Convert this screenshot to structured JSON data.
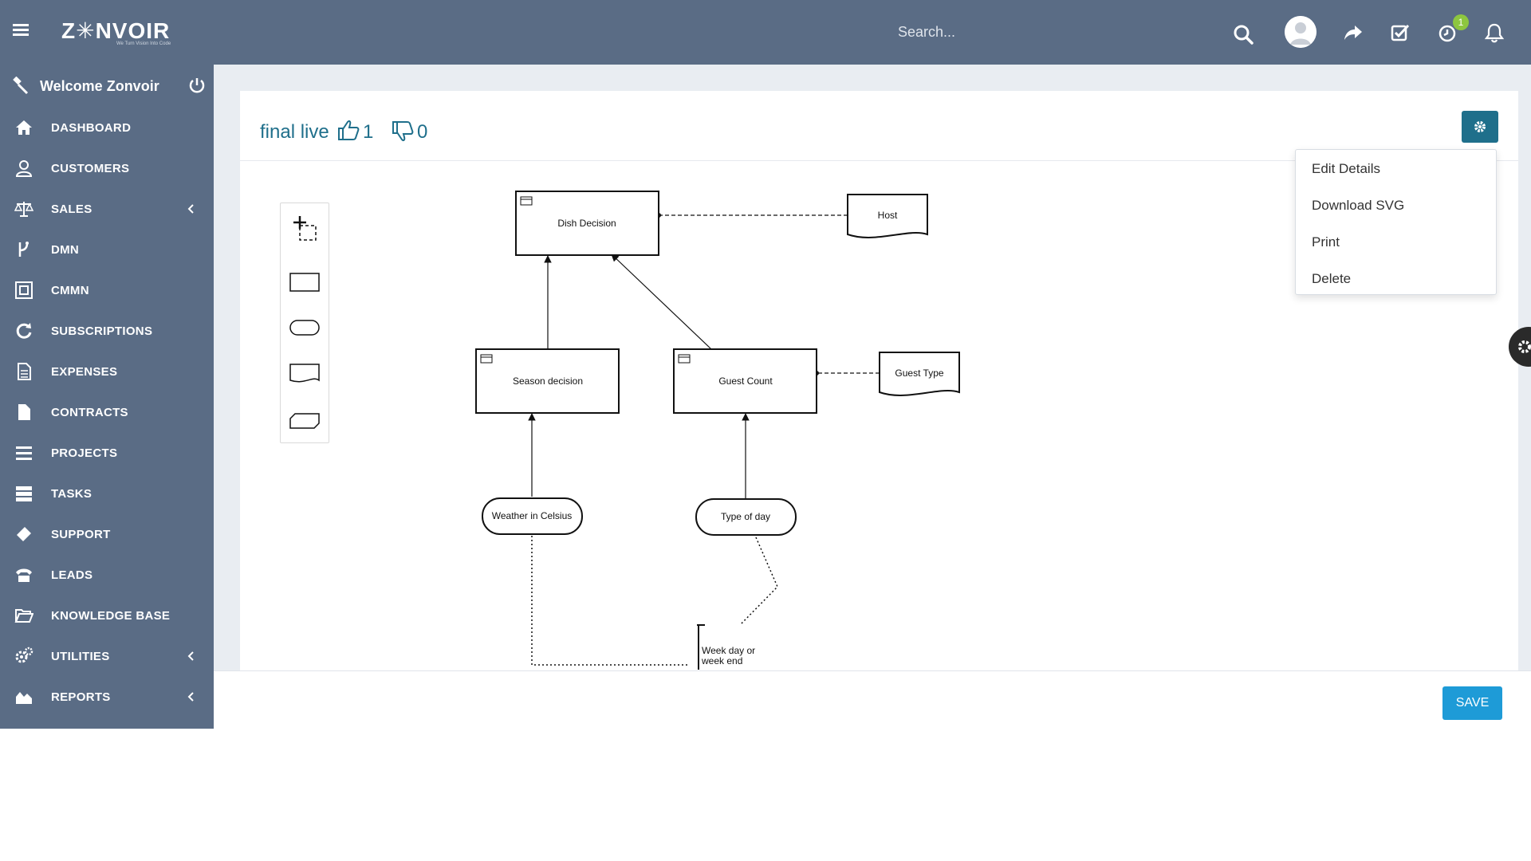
{
  "header": {
    "logo_text": "Z✳NVOIR",
    "logo_tagline": "We Turn Vision Into Code",
    "search_placeholder": "Search...",
    "notification_badge": "1"
  },
  "sidebar": {
    "welcome": "Welcome Zonvoir",
    "items": [
      {
        "label": "DASHBOARD",
        "icon": "home-icon"
      },
      {
        "label": "CUSTOMERS",
        "icon": "user-icon"
      },
      {
        "label": "SALES",
        "icon": "balance-scale-icon",
        "has_submenu": true
      },
      {
        "label": "DMN",
        "icon": "branch-icon"
      },
      {
        "label": "CMMN",
        "icon": "frame-icon"
      },
      {
        "label": "SUBSCRIPTIONS",
        "icon": "refresh-icon"
      },
      {
        "label": "EXPENSES",
        "icon": "document-icon"
      },
      {
        "label": "CONTRACTS",
        "icon": "file-icon"
      },
      {
        "label": "PROJECTS",
        "icon": "list-icon"
      },
      {
        "label": "TASKS",
        "icon": "tasks-icon"
      },
      {
        "label": "SUPPORT",
        "icon": "ticket-icon"
      },
      {
        "label": "LEADS",
        "icon": "phone-icon"
      },
      {
        "label": "KNOWLEDGE BASE",
        "icon": "folder-open-icon"
      },
      {
        "label": "UTILITIES",
        "icon": "cogs-icon",
        "has_submenu": true
      },
      {
        "label": "REPORTS",
        "icon": "area-chart-icon",
        "has_submenu": true
      }
    ]
  },
  "page": {
    "title": "final live",
    "likes": "1",
    "dislikes": "0",
    "settings_menu": [
      "Edit Details",
      "Download SVG",
      "Print",
      "Delete"
    ],
    "save_label": "SAVE"
  },
  "diagram": {
    "nodes": {
      "dish_decision": "Dish Decision",
      "host": "Host",
      "season_decision": "Season decision",
      "guest_count": "Guest Count",
      "guest_type": "Guest Type",
      "weather": "Weather in Celsius",
      "type_of_day": "Type of day",
      "annotation_line1": "Week day or",
      "annotation_line2": "week end"
    }
  },
  "colors": {
    "sidebar_bg": "#5a6c85",
    "accent": "#1f6f8b",
    "save_button": "#1e9bd7",
    "badge": "#8dc63f"
  }
}
